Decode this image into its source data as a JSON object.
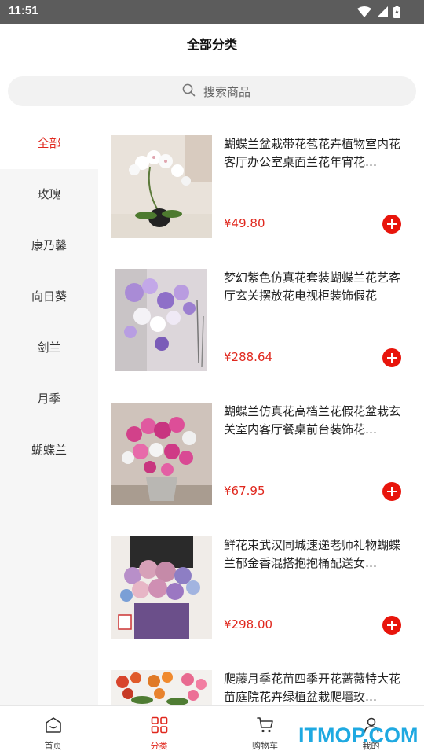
{
  "status_bar": {
    "time": "11:51",
    "icons": [
      "wifi-icon",
      "cellular-icon",
      "battery-icon"
    ]
  },
  "header": {
    "title": "全部分类"
  },
  "search": {
    "placeholder": "搜索商品",
    "icon": "search-icon"
  },
  "sidebar": {
    "items": [
      {
        "label": "全部",
        "active": true
      },
      {
        "label": "玫瑰",
        "active": false
      },
      {
        "label": "康乃馨",
        "active": false
      },
      {
        "label": "向日葵",
        "active": false
      },
      {
        "label": "剑兰",
        "active": false
      },
      {
        "label": "月季",
        "active": false
      },
      {
        "label": "蝴蝶兰",
        "active": false
      }
    ]
  },
  "products": [
    {
      "title": "蝴蝶兰盆栽带花苞花卉植物室内花客厅办公室桌面兰花年宵花…",
      "price": "¥49.80"
    },
    {
      "title": "梦幻紫色仿真花套装蝴蝶兰花艺客厅玄关摆放花电视柜装饰假花",
      "price": "¥288.64"
    },
    {
      "title": "蝴蝶兰仿真花高档兰花假花盆栽玄关室内客厅餐桌前台装饰花…",
      "price": "¥67.95"
    },
    {
      "title": "鲜花束武汉同城速递老师礼物蝴蝶兰郁金香混搭抱抱桶配送女…",
      "price": "¥298.00"
    },
    {
      "title": "爬藤月季花苗四季开花蔷薇特大花苗庭院花卉绿植盆栽爬墙玫…",
      "price": ""
    }
  ],
  "tab_bar": {
    "tabs": [
      {
        "label": "首页",
        "icon": "home-icon",
        "active": false
      },
      {
        "label": "分类",
        "icon": "category-grid-icon",
        "active": true
      },
      {
        "label": "购物车",
        "icon": "cart-icon",
        "active": false
      },
      {
        "label": "我的",
        "icon": "user-icon",
        "active": false
      }
    ]
  },
  "watermark": {
    "text": "ITMOP.COM"
  },
  "colors": {
    "accent": "#e0281e",
    "add_button": "#e8150c",
    "status_bar": "#5c5c5c",
    "sidebar_bg": "#f6f6f6",
    "watermark": "#1fa9e1"
  }
}
